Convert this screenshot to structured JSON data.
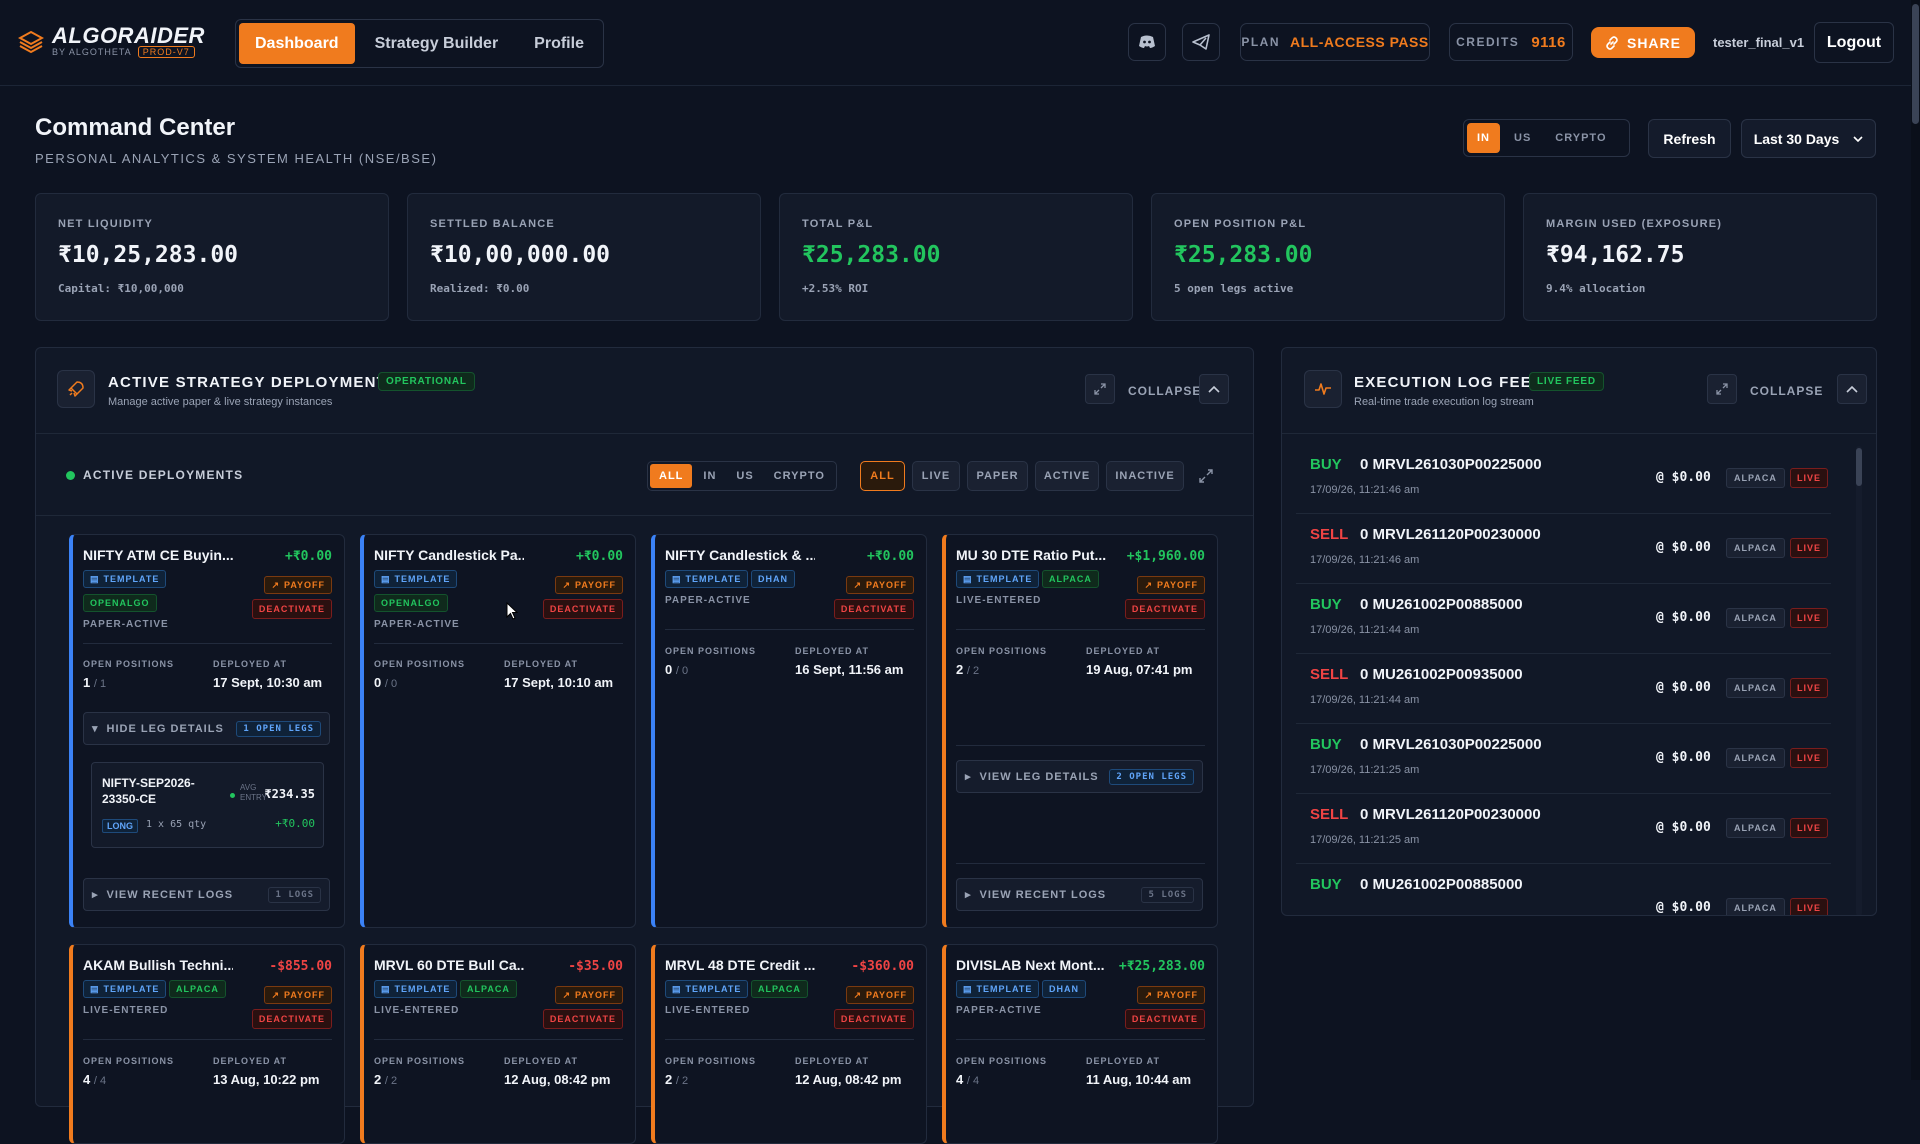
{
  "app": {
    "name": "ALGORAIDER",
    "byline": "BY ALGOTHETA",
    "env": "PROD-V7"
  },
  "nav": {
    "tabs": [
      {
        "label": "Dashboard",
        "active": true
      },
      {
        "label": "Strategy Builder",
        "active": false
      },
      {
        "label": "Profile",
        "active": false
      }
    ]
  },
  "topbar": {
    "plan_label": "PLAN",
    "plan_value": "ALL-ACCESS PASS",
    "credits_label": "CREDITS",
    "credits_value": "9116",
    "share_label": "SHARE",
    "username": "tester_final_v1",
    "logout_label": "Logout",
    "icons": [
      "discord-icon",
      "telegram-icon",
      "link-icon"
    ]
  },
  "header": {
    "title": "Command Center",
    "subtitle": "PERSONAL ANALYTICS & SYSTEM HEALTH (NSE/BSE)",
    "regions": [
      "IN",
      "US",
      "CRYPTO"
    ],
    "active_region": "IN",
    "refresh_label": "Refresh",
    "range_label": "Last 30 Days"
  },
  "stats": [
    {
      "label": "NET LIQUIDITY",
      "value": "₹10,25,283.00",
      "sub": "Capital: ₹10,00,000",
      "tone": "neutral"
    },
    {
      "label": "SETTLED BALANCE",
      "value": "₹10,00,000.00",
      "sub": "Realized: ₹0.00",
      "tone": "neutral"
    },
    {
      "label": "TOTAL P&L",
      "value": "₹25,283.00",
      "sub": "+2.53% ROI",
      "tone": "positive"
    },
    {
      "label": "OPEN POSITION P&L",
      "value": "₹25,283.00",
      "sub": "5 open legs active",
      "tone": "positive"
    },
    {
      "label": "MARGIN USED (EXPOSURE)",
      "value": "₹94,162.75",
      "sub": "9.4% allocation",
      "tone": "neutral"
    }
  ],
  "deployments": {
    "title": "ACTIVE STRATEGY DEPLOYMENTS",
    "status": "OPERATIONAL",
    "subtitle": "Manage active paper & live strategy instances",
    "collapse_label": "COLLAPSE",
    "section_label": "ACTIVE DEPLOYMENTS",
    "region_filters": [
      "ALL",
      "IN",
      "US",
      "CRYPTO"
    ],
    "mode_filters": [
      "ALL",
      "LIVE",
      "PAPER",
      "ACTIVE",
      "INACTIVE"
    ],
    "labels": {
      "template": "TEMPLATE",
      "payoff": "PAYOFF",
      "deactivate": "DEACTIVATE",
      "open_positions": "OPEN POSITIONS",
      "deployed_at": "DEPLOYED AT",
      "hide_legs": "HIDE LEG DETAILS",
      "view_legs": "VIEW LEG DETAILS",
      "view_logs": "VIEW RECENT LOGS"
    },
    "cards": [
      {
        "title": "NIFTY ATM CE Buyin...",
        "pnl": "+₹0.00",
        "broker": "OPENALGO",
        "status": "PAPER-ACTIVE",
        "open": "1",
        "total": "1",
        "deployed": "17 Sept, 10:30 am",
        "color": "blue",
        "legs_count": "1 OPEN LEGS",
        "logs_count": "1 LOGS",
        "leg": {
          "symbol": "NIFTY-SEP2026-23350-CE",
          "side": "LONG",
          "qty": "1 x 65 qty",
          "avg_label": "AVG ENTRY",
          "avg": "₹234.35",
          "pnl": "+₹0.00"
        }
      },
      {
        "title": "NIFTY Candlestick Pa...",
        "pnl": "+₹0.00",
        "broker": "OPENALGO",
        "status": "PAPER-ACTIVE",
        "open": "0",
        "total": "0",
        "deployed": "17 Sept, 10:10 am",
        "color": "blue"
      },
      {
        "title": "NIFTY Candlestick & ...",
        "pnl": "+₹0.00",
        "broker": "DHAN",
        "status": "PAPER-ACTIVE",
        "open": "0",
        "total": "0",
        "deployed": "16 Sept, 11:56 am",
        "color": "blue"
      },
      {
        "title": "MU 30 DTE Ratio Put...",
        "pnl": "+$1,960.00",
        "broker": "ALPACA",
        "status": "LIVE-ENTERED",
        "open": "2",
        "total": "2",
        "deployed": "19 Aug, 07:41 pm",
        "color": "orange",
        "legs_count": "2 OPEN LEGS",
        "logs_count": "5 LOGS"
      },
      {
        "title": "AKAM Bullish Techni...",
        "pnl": "-$855.00",
        "broker": "ALPACA",
        "status": "LIVE-ENTERED",
        "open": "4",
        "total": "4",
        "deployed": "13 Aug, 10:22 pm",
        "color": "orange"
      },
      {
        "title": "MRVL 60 DTE Bull Ca...",
        "pnl": "-$35.00",
        "broker": "ALPACA",
        "status": "LIVE-ENTERED",
        "open": "2",
        "total": "2",
        "deployed": "12 Aug, 08:42 pm",
        "color": "orange"
      },
      {
        "title": "MRVL 48 DTE Credit ...",
        "pnl": "-$360.00",
        "broker": "ALPACA",
        "status": "LIVE-ENTERED",
        "open": "2",
        "total": "2",
        "deployed": "12 Aug, 08:42 pm",
        "color": "orange"
      },
      {
        "title": "DIVISLAB Next Mont...",
        "pnl": "+₹25,283.00",
        "broker": "DHAN",
        "status": "PAPER-ACTIVE",
        "open": "4",
        "total": "4",
        "deployed": "11 Aug, 10:44 am",
        "color": "orange"
      }
    ]
  },
  "log_feed": {
    "title": "EXECUTION LOG FEED",
    "badge": "LIVE FEED",
    "subtitle": "Real-time trade execution log stream",
    "collapse_label": "COLLAPSE",
    "entries": [
      {
        "side": "BUY",
        "symbol": "0 MRVL261030P00225000",
        "time": "17/09/26, 11:21:46 am",
        "price": "@ $0.00",
        "broker": "ALPACA",
        "mode": "LIVE"
      },
      {
        "side": "SELL",
        "symbol": "0 MRVL261120P00230000",
        "time": "17/09/26, 11:21:46 am",
        "price": "@ $0.00",
        "broker": "ALPACA",
        "mode": "LIVE"
      },
      {
        "side": "BUY",
        "symbol": "0 MU261002P00885000",
        "time": "17/09/26, 11:21:44 am",
        "price": "@ $0.00",
        "broker": "ALPACA",
        "mode": "LIVE"
      },
      {
        "side": "SELL",
        "symbol": "0 MU261002P00935000",
        "time": "17/09/26, 11:21:44 am",
        "price": "@ $0.00",
        "broker": "ALPACA",
        "mode": "LIVE"
      },
      {
        "side": "BUY",
        "symbol": "0 MRVL261030P00225000",
        "time": "17/09/26, 11:21:25 am",
        "price": "@ $0.00",
        "broker": "ALPACA",
        "mode": "LIVE"
      },
      {
        "side": "SELL",
        "symbol": "0 MRVL261120P00230000",
        "time": "17/09/26, 11:21:25 am",
        "price": "@ $0.00",
        "broker": "ALPACA",
        "mode": "LIVE"
      },
      {
        "side": "BUY",
        "symbol": "0 MU261002P00885000",
        "time": "",
        "price": "@ $0.00",
        "broker": "ALPACA",
        "mode": "LIVE"
      }
    ]
  },
  "colors": {
    "accent": "#f07b1e",
    "positive": "#22c55e",
    "negative": "#ef4444",
    "paper": "#3b82f6",
    "background": "#0d1321"
  }
}
